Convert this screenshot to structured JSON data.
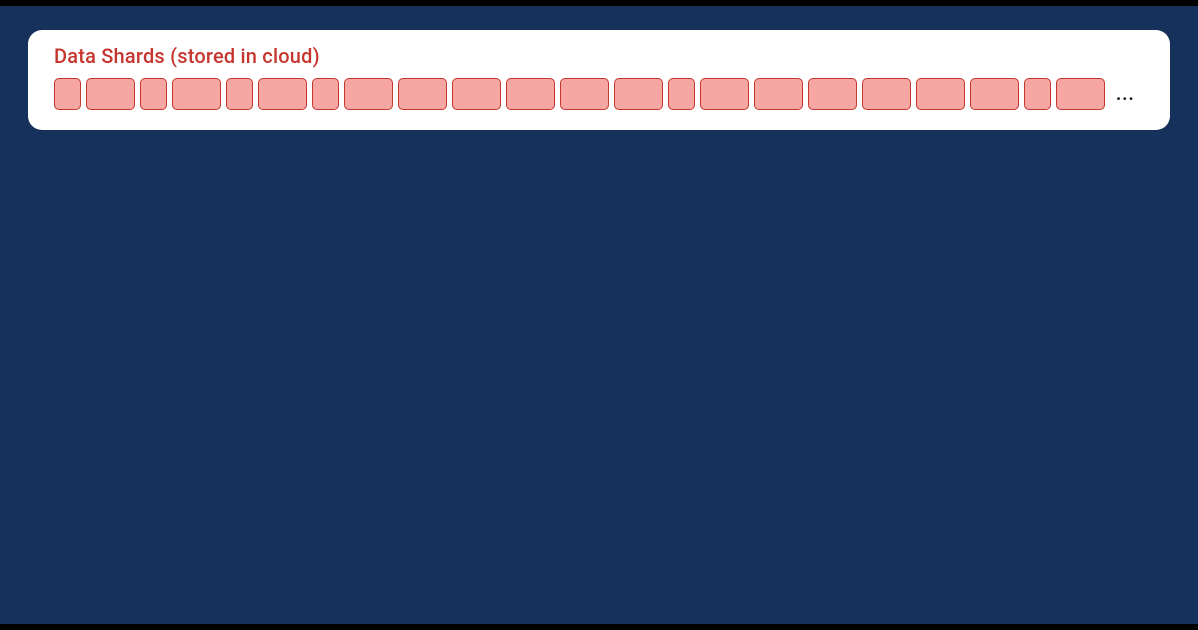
{
  "panel": {
    "title": "Data Shards (stored in cloud)",
    "ellipsis": "...",
    "shards": [
      {
        "kind": "narrow"
      },
      {
        "kind": "wide"
      },
      {
        "kind": "narrow"
      },
      {
        "kind": "wide"
      },
      {
        "kind": "narrow"
      },
      {
        "kind": "wide"
      },
      {
        "kind": "narrow"
      },
      {
        "kind": "wide"
      },
      {
        "kind": "wide"
      },
      {
        "kind": "wide"
      },
      {
        "kind": "wide"
      },
      {
        "kind": "wide"
      },
      {
        "kind": "wide"
      },
      {
        "kind": "narrow"
      },
      {
        "kind": "wide"
      },
      {
        "kind": "wide"
      },
      {
        "kind": "wide"
      },
      {
        "kind": "wide"
      },
      {
        "kind": "wide"
      },
      {
        "kind": "wide"
      },
      {
        "kind": "narrow"
      },
      {
        "kind": "wide"
      }
    ]
  },
  "colors": {
    "page_bg": "#16325c",
    "card_bg": "#ffffff",
    "accent": "#c6362f",
    "shard_fill": "#f6a7a3",
    "shard_border": "#c6362f"
  }
}
